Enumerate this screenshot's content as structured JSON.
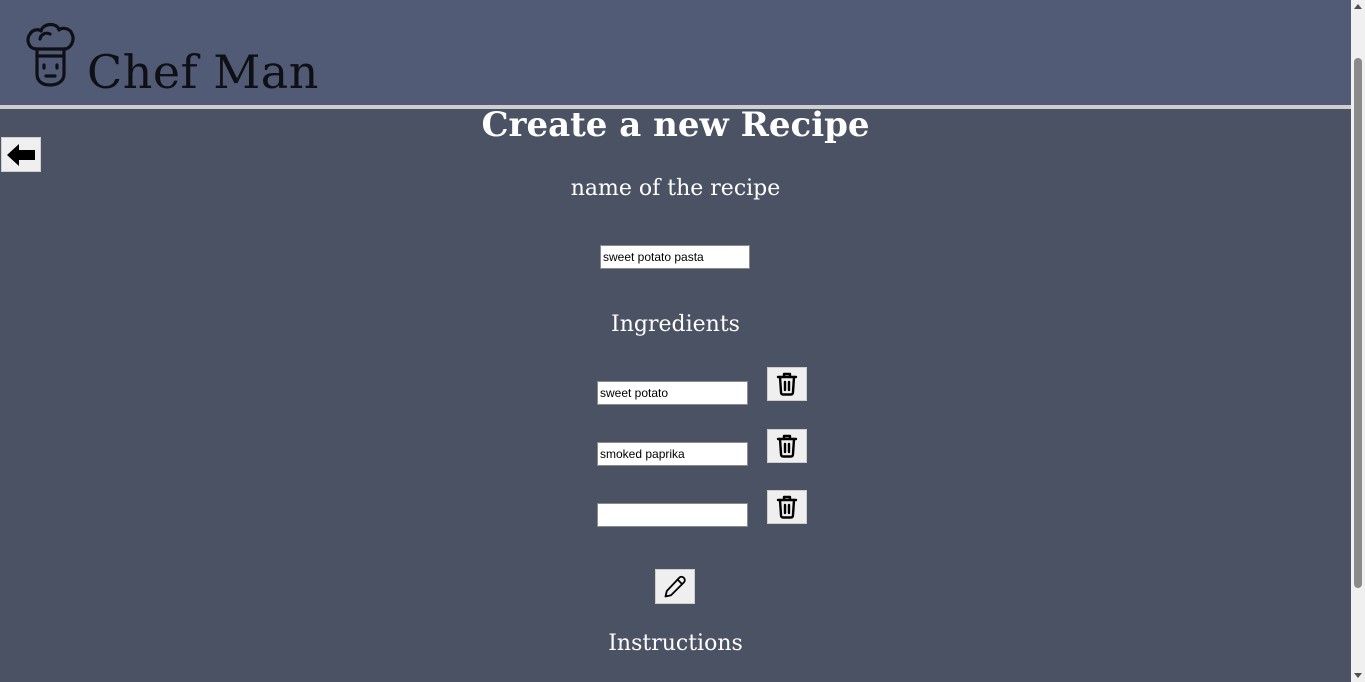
{
  "header": {
    "brand": "Chef Man",
    "logo_icon": "chef-hat-face-icon"
  },
  "back_button": {
    "icon": "arrow-left-icon"
  },
  "form": {
    "title": "Create a new Recipe",
    "name_label": "name of the recipe",
    "recipe_name_value": "sweet potato pasta",
    "ingredients_label": "Ingredients",
    "ingredients": [
      {
        "value": "sweet potato",
        "delete_icon": "trash-icon"
      },
      {
        "value": "smoked paprika",
        "delete_icon": "trash-icon"
      },
      {
        "value": "",
        "delete_icon": "trash-icon"
      }
    ],
    "add_ingredient_icon": "pencil-icon",
    "instructions_label": "Instructions"
  },
  "colors": {
    "header_background": "#525b75",
    "page_background": "#4a5264",
    "header_divider": "#cfcfcf",
    "text_light": "#ffffff",
    "brand_text": "#0f1016"
  }
}
